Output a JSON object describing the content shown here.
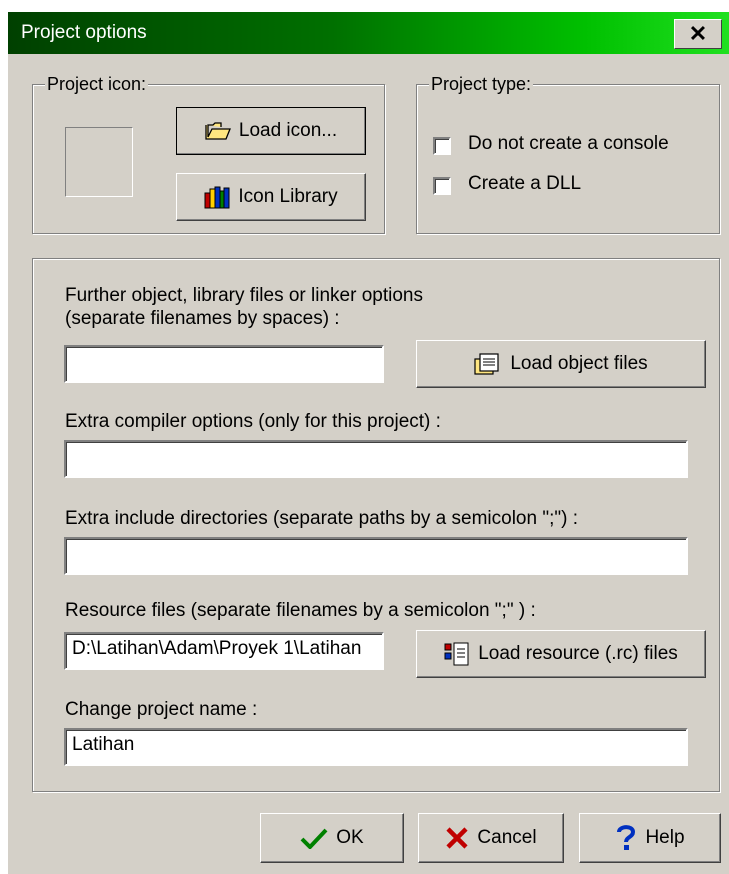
{
  "window": {
    "title": "Project options",
    "close_label": "✕"
  },
  "project_icon": {
    "group_label": "Project icon:",
    "load_icon_label": "Load icon...",
    "icon_library_label": "Icon Library"
  },
  "project_type": {
    "group_label": "Project type:",
    "no_console_label": "Do not create a console",
    "no_console_checked": false,
    "create_dll_label": "Create a DLL",
    "create_dll_checked": false
  },
  "linker": {
    "label_line1": "Further object, library files or linker options",
    "label_line2": "(separate filenames by spaces) :",
    "value": "",
    "load_object_label": "Load object files"
  },
  "compiler": {
    "label": "Extra compiler options (only for this project) :",
    "value": ""
  },
  "include": {
    "label": "Extra include directories (separate paths by a semicolon \";\") :",
    "value": ""
  },
  "resource": {
    "label": "Resource files (separate filenames by a semicolon \";\" ) :",
    "value": "D:\\Latihan\\Adam\\Proyek 1\\Latihan",
    "load_resource_label": "Load resource (.rc) files"
  },
  "project_name": {
    "label": "Change project name :",
    "value": "Latihan"
  },
  "footer": {
    "ok_label": "OK",
    "cancel_label": "Cancel",
    "help_label": "Help"
  },
  "colors": {
    "titlebar_start": "#004000",
    "titlebar_end": "#20e020",
    "dialog_bg": "#d4d0c8"
  }
}
